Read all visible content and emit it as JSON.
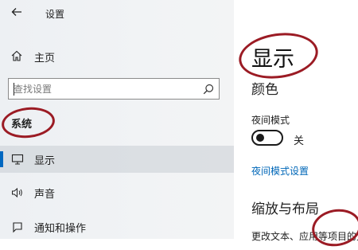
{
  "window": {
    "title": "设置",
    "back_icon": "back-arrow-icon"
  },
  "sidebar": {
    "home": {
      "label": "主页",
      "icon": "home-icon"
    },
    "search": {
      "placeholder": "查找设置",
      "icon": "search-icon"
    },
    "section_label": "系统",
    "items": [
      {
        "label": "显示",
        "icon": "monitor-icon",
        "active": true
      },
      {
        "label": "声音",
        "icon": "speaker-icon",
        "active": false
      },
      {
        "label": "通知和操作",
        "icon": "notification-icon",
        "active": false
      }
    ]
  },
  "content": {
    "title": "显示",
    "color_heading": "颜色",
    "night_mode_label": "夜间模式",
    "night_mode_state": "关",
    "night_mode_on": false,
    "night_mode_link": "夜间模式设置",
    "scale_heading": "缩放与布局",
    "partial_line": "更改文本、应用等项目的大小"
  },
  "colors": {
    "accent": "#0067c0",
    "link": "#0067b8",
    "annotation": "#9b1b24"
  }
}
